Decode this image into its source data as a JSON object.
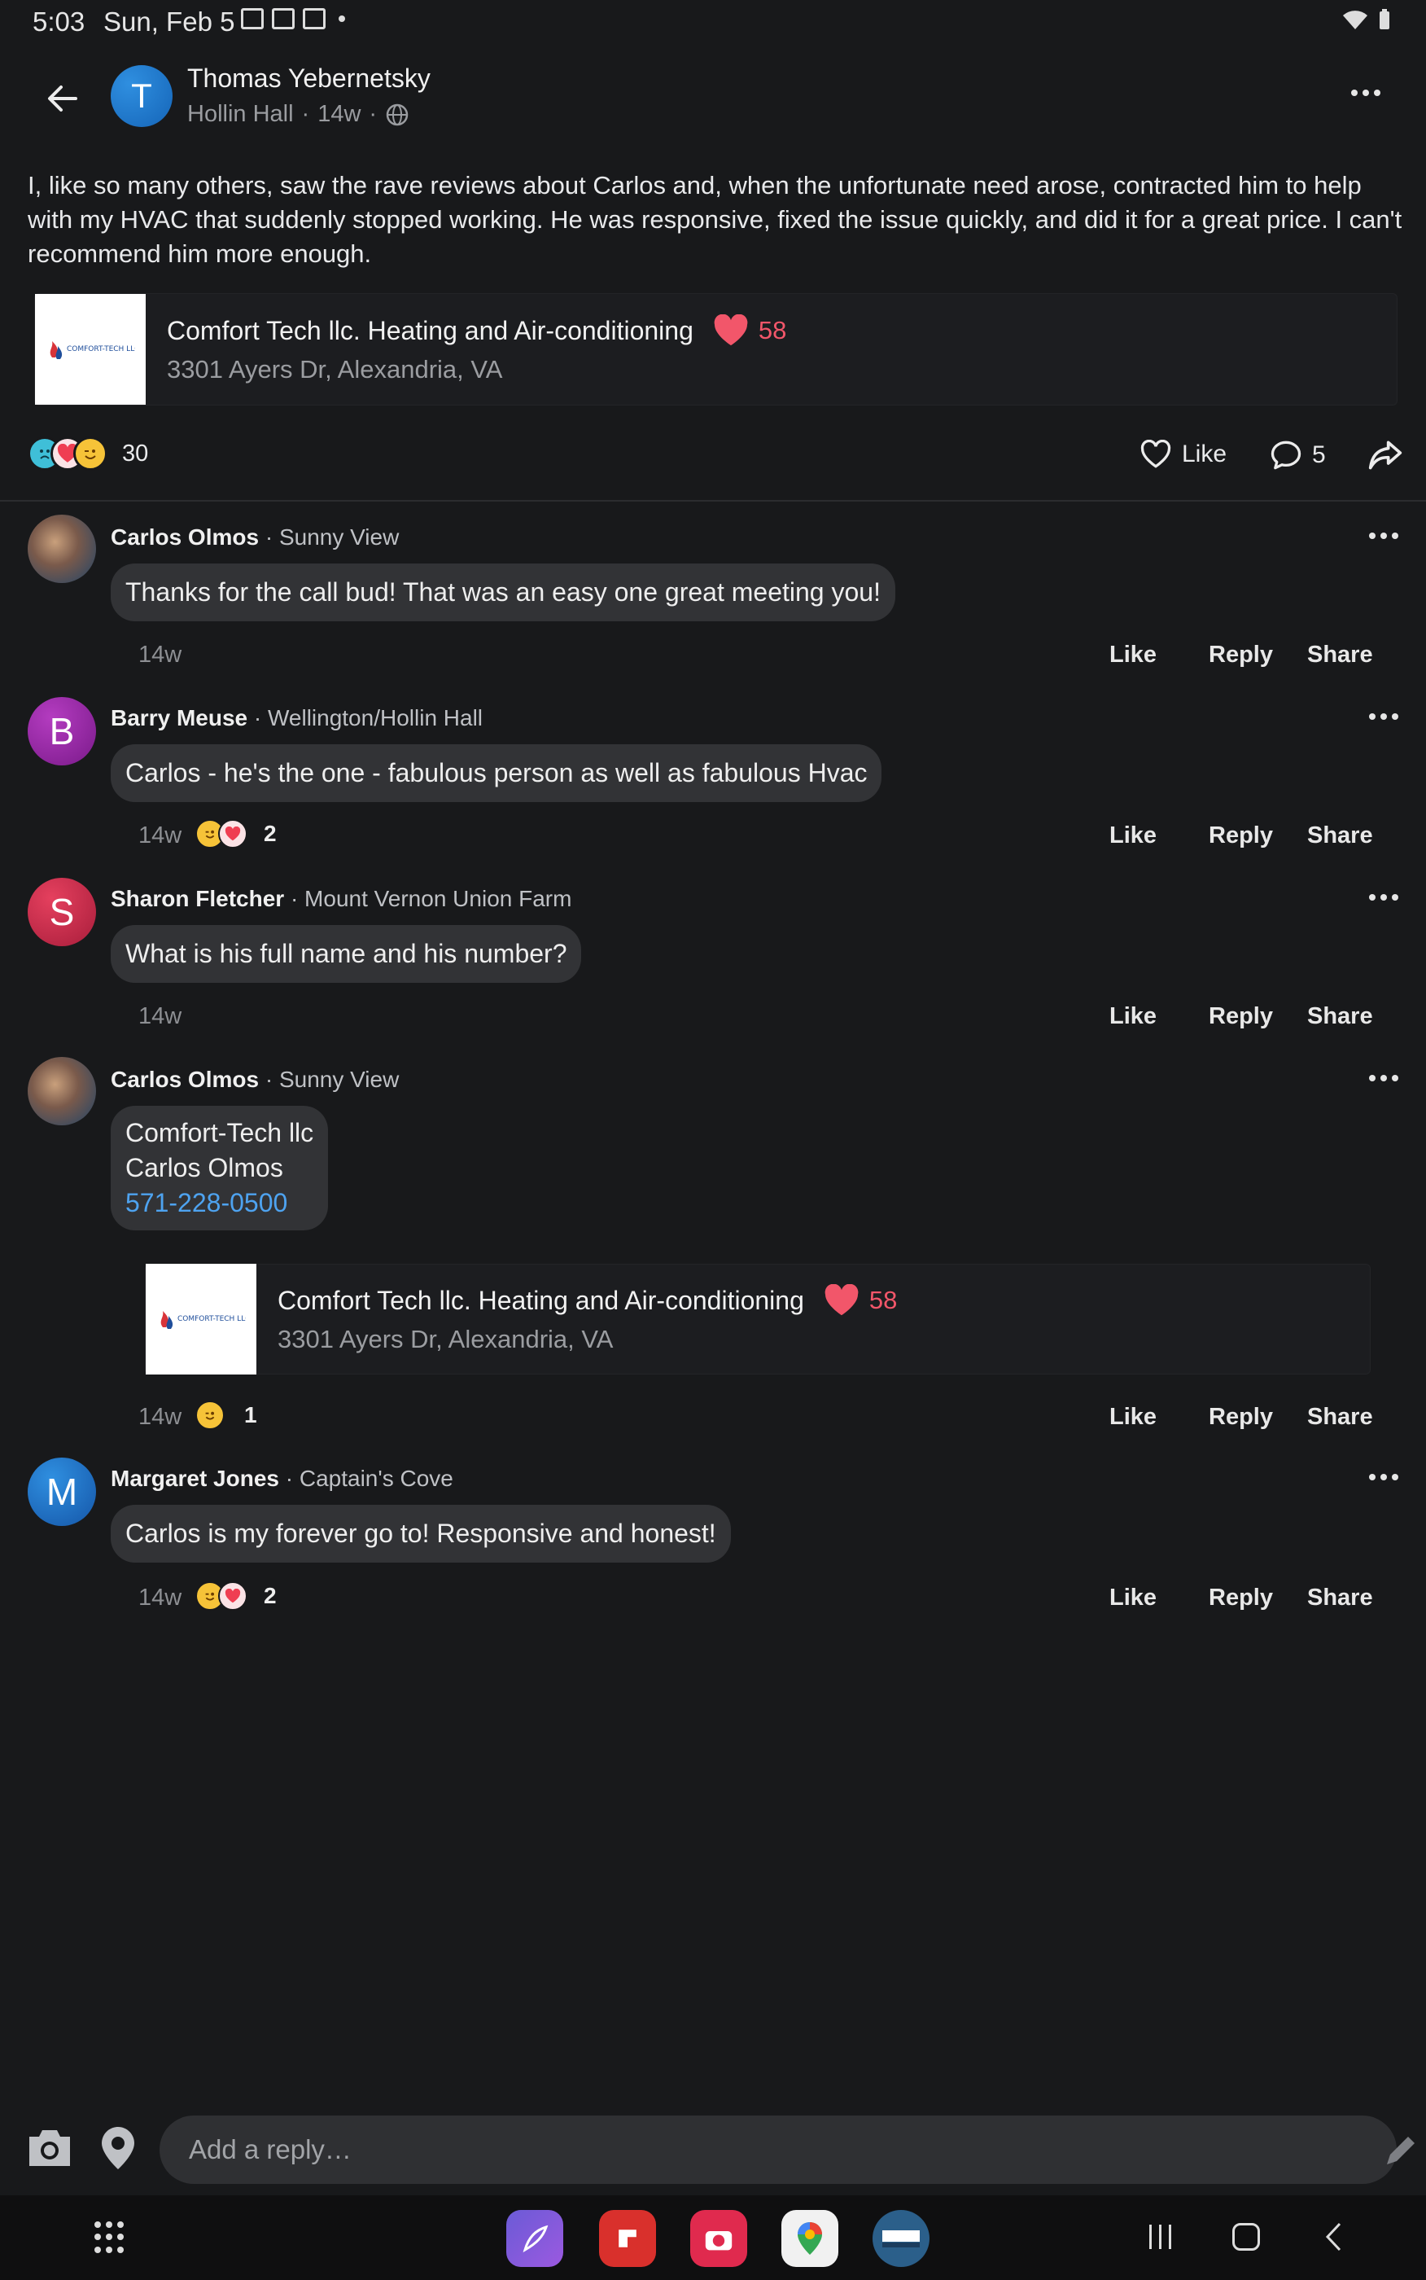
{
  "status_bar": {
    "time": "5:03",
    "date": "Sun, Feb 5"
  },
  "post": {
    "author_initial": "T",
    "author": "Thomas Yebernetsky",
    "neighborhood": "Hollin Hall",
    "age": "14w",
    "sep": "·",
    "body": "I, like so many others, saw the rave reviews about Carlos and, when the unfortunate need arose, contracted him to help with my HVAC that suddenly stopped working. He was responsive, fixed the issue quickly, and did it for a great price. I can't recommend him more enough.",
    "business": {
      "name": "Comfort Tech llc. Heating and Air-conditioning",
      "likes": "58",
      "address": "3301 Ayers Dr, Alexandria, VA",
      "logo_text": "COMFORT-TECH LLC"
    },
    "reaction_count": "30",
    "like_label": "Like",
    "comment_count": "5"
  },
  "comments": [
    {
      "author": "Carlos Olmos",
      "place": "· Sunny View",
      "text": "Thanks for the call bud!  That was an easy one great meeting you!",
      "time": "14w"
    },
    {
      "initial": "B",
      "author": "Barry Meuse",
      "place": "· Wellington/Hollin Hall",
      "text": "Carlos - he's the one - fabulous person as well as fabulous Hvac",
      "time": "14w",
      "reactions": "2"
    },
    {
      "initial": "S",
      "author": "Sharon Fletcher",
      "place": "· Mount Vernon Union Farm",
      "text": "What is his full name and his number?",
      "time": "14w"
    },
    {
      "author": "Carlos Olmos",
      "place": "· Sunny View",
      "line1": "Comfort-Tech llc",
      "line2": "Carlos Olmos",
      "phone": "571-228-0500",
      "time": "14w",
      "reactions": "1"
    },
    {
      "initial": "M",
      "author": "Margaret Jones",
      "place": "· Captain's Cove",
      "text": "Carlos is my forever go to!  Responsive and honest!",
      "time": "14w",
      "reactions": "2"
    }
  ],
  "actions": {
    "like": "Like",
    "reply": "Reply",
    "share": "Share"
  },
  "reply_box": {
    "placeholder": "Add a reply…"
  },
  "colors": {
    "background": "#18191b",
    "bubble": "#323336",
    "heart": "#f2566a",
    "link": "#4ea3f0"
  },
  "icons": [
    "back-arrow-icon",
    "globe-icon",
    "heart-outline-icon",
    "comment-icon",
    "share-icon",
    "camera-icon",
    "location-pin-icon",
    "pencil-icon"
  ]
}
